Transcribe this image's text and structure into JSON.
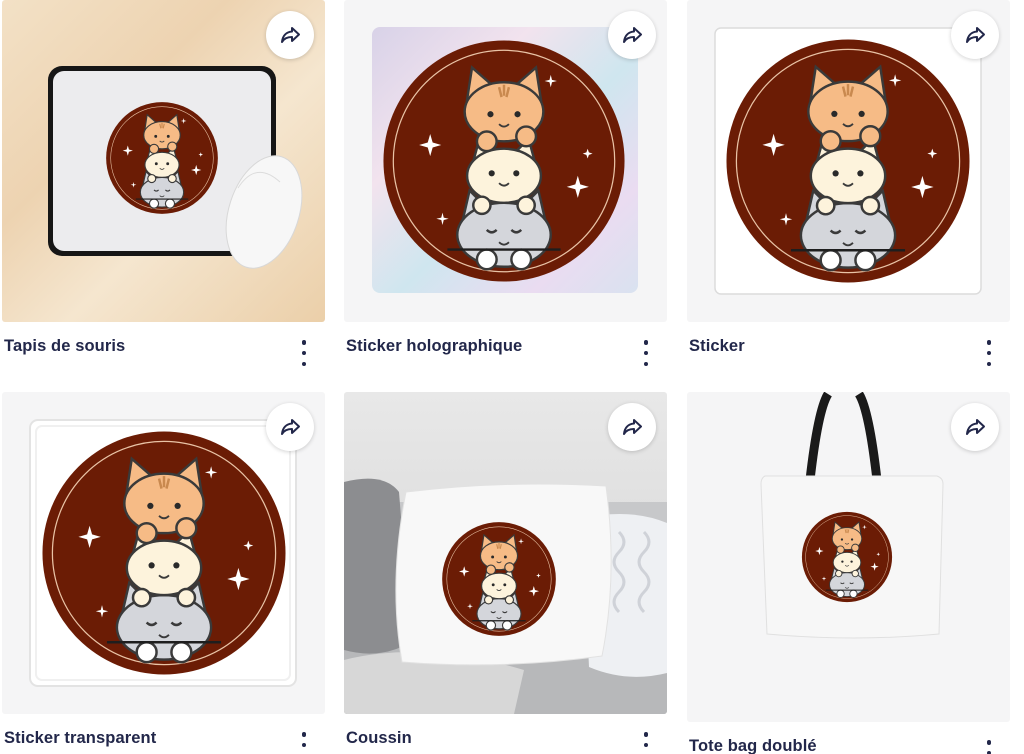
{
  "products": [
    {
      "title": "Tapis de souris",
      "scene": "mousepad"
    },
    {
      "title": "Sticker holographique",
      "scene": "holo"
    },
    {
      "title": "Sticker",
      "scene": "sticker"
    },
    {
      "title": "Sticker transparent",
      "scene": "transparent"
    },
    {
      "title": "Coussin",
      "scene": "pillow"
    },
    {
      "title": "Tote bag doublé",
      "scene": "tote"
    }
  ],
  "icons": {
    "share": "share-arrow-icon",
    "more": "more-vertical-icon"
  },
  "colors": {
    "badge": "#6b1c05",
    "cat_orange": "#f6bb86",
    "cat_cream": "#fdf3dc",
    "cat_gray": "#d4d6db",
    "text": "#22274a"
  }
}
